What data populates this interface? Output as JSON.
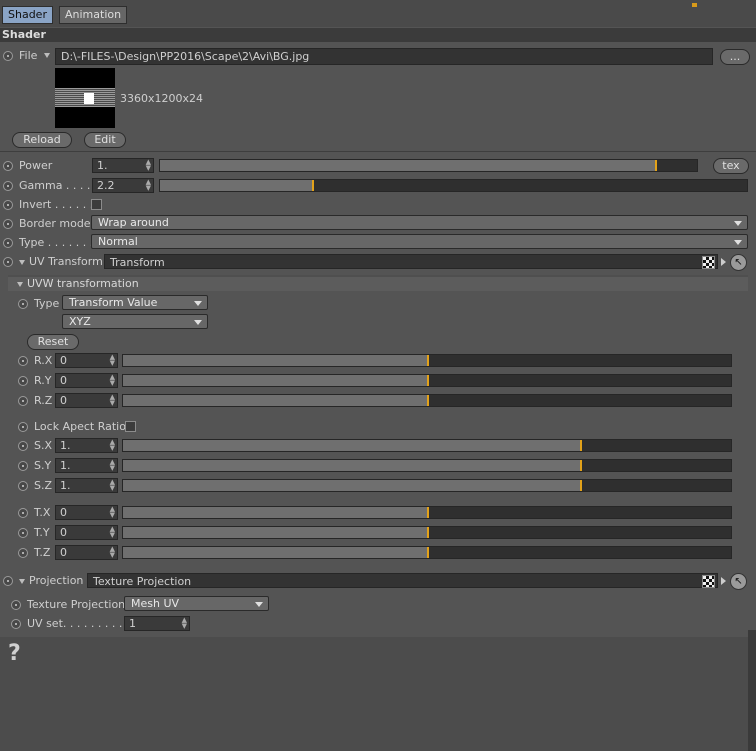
{
  "tabs": [
    {
      "label": "Shader",
      "active": true
    },
    {
      "label": "Animation",
      "active": false
    }
  ],
  "section_title": "Shader",
  "file": {
    "label": "File",
    "path": "D:\\-FILES-\\Design\\PP2016\\Scape\\2\\Avi\\BG.jpg",
    "browse_label": "...",
    "image_info": "3360x1200x24"
  },
  "buttons": {
    "reload": "Reload",
    "edit": "Edit",
    "tex": "tex",
    "reset": "Reset"
  },
  "power": {
    "label": "Power",
    "value": "1.",
    "level": 0.92
  },
  "gamma": {
    "label": "Gamma . . . . .",
    "value": "2.2",
    "level": 0.26
  },
  "invert": {
    "label": "Invert . . . . . .",
    "checked": false
  },
  "border_mode": {
    "label": "Border mode",
    "value": "Wrap around"
  },
  "type": {
    "label": "Type . . . . . . .",
    "value": "Normal"
  },
  "uv_transform": {
    "label": "UV Transform",
    "value": "Transform"
  },
  "uvw": {
    "header": "UVW transformation",
    "type_label": "Type",
    "type_value": "Transform Value",
    "order_value": "XYZ",
    "rotation": [
      {
        "label": "R.X",
        "value": "0",
        "level": 0.5
      },
      {
        "label": "R.Y",
        "value": "0",
        "level": 0.5
      },
      {
        "label": "R.Z",
        "value": "0",
        "level": 0.5
      }
    ],
    "lock_label": "Lock Apect Ratio",
    "scale": [
      {
        "label": "S.X",
        "value": "1.",
        "level": 0.75
      },
      {
        "label": "S.Y",
        "value": "1.",
        "level": 0.75
      },
      {
        "label": "S.Z",
        "value": "1.",
        "level": 0.75
      }
    ],
    "translation": [
      {
        "label": "T.X",
        "value": "0",
        "level": 0.5
      },
      {
        "label": "T.Y",
        "value": "0",
        "level": 0.5
      },
      {
        "label": "T.Z",
        "value": "0",
        "level": 0.5
      }
    ]
  },
  "projection": {
    "label": "Projection",
    "value": "Texture Projection"
  },
  "texture_projection": {
    "label": "Texture Projection",
    "value": "Mesh UV"
  },
  "uv_set": {
    "label": "UV set. . . . . . . . . .",
    "value": "1"
  },
  "help_glyph": "?",
  "colors": {
    "accent": "#e3a21a",
    "active_tab": "#8aa4c6",
    "panel": "#545454"
  },
  "icons": [
    "radio-icon",
    "dropdown-arrow-icon",
    "triangle-expand-icon",
    "checker-icon",
    "pointer-icon",
    "help-icon"
  ]
}
